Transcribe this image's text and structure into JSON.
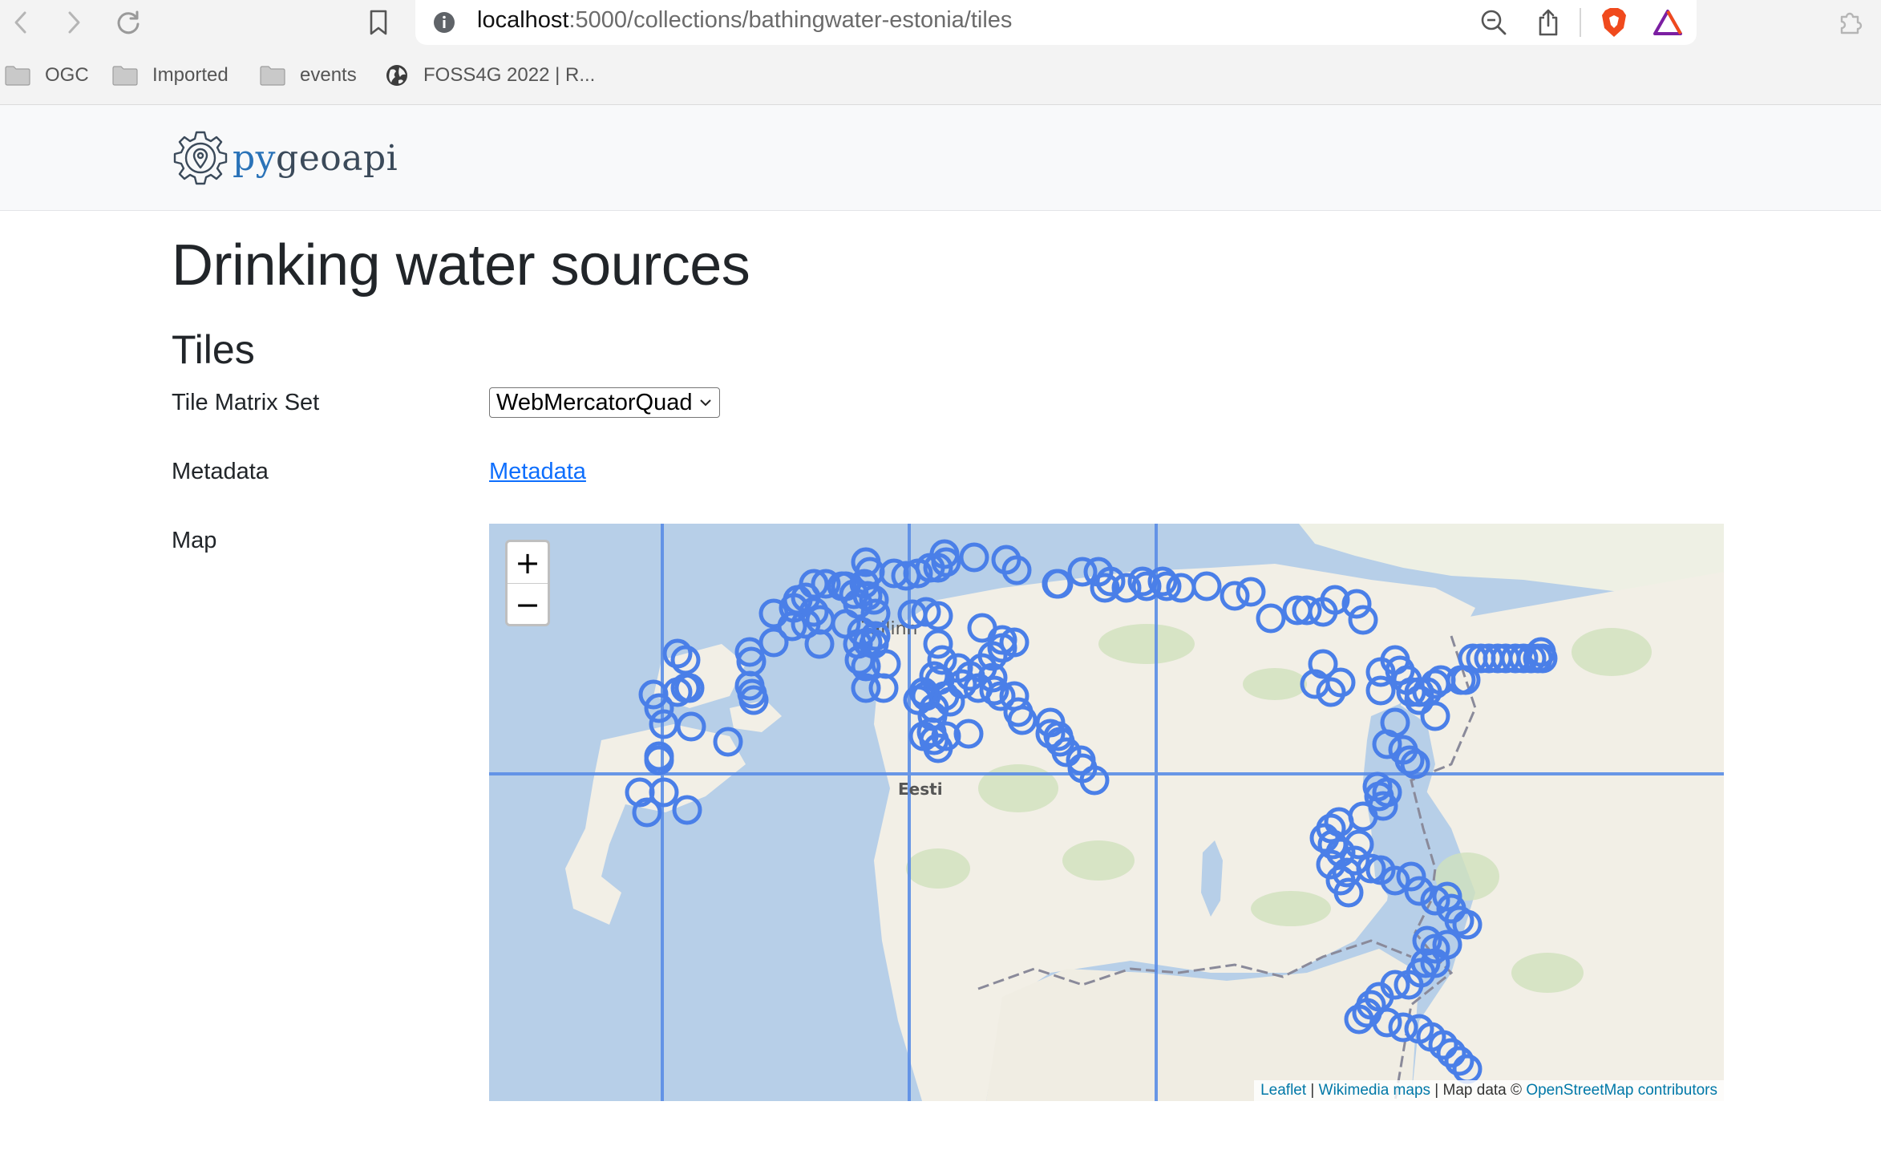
{
  "browser": {
    "url_host": "localhost",
    "url_path": ":5000/collections/bathingwater-estonia/tiles",
    "bookmarks": [
      {
        "label": "OGC",
        "icon": "folder-icon"
      },
      {
        "label": "Imported",
        "icon": "folder-icon"
      },
      {
        "label": "events",
        "icon": "folder-icon"
      },
      {
        "label": "FOSS4G 2022 | R...",
        "icon": "globe-icon"
      }
    ]
  },
  "site": {
    "logo_prefix": "py",
    "logo_suffix": "geoapi"
  },
  "page": {
    "title": "Drinking water sources",
    "section": "Tiles",
    "tms_label": "Tile Matrix Set",
    "tms_selected": "WebMercatorQuad",
    "metadata_label": "Metadata",
    "metadata_link": "Metadata",
    "map_label": "Map"
  },
  "map": {
    "zoom_in": "+",
    "zoom_out": "−",
    "country_label": "Eesti",
    "city_label": "Tallinn",
    "attribution": {
      "leaflet": "Leaflet",
      "sep1": " | ",
      "wikimedia": "Wikimedia maps",
      "mapdata": " | Map data © ",
      "osm": "OpenStreetMap contributors"
    },
    "colors": {
      "marker": "#4a7fe8",
      "grid": "#5a8de6",
      "sea": "#b7cfe8",
      "land": "#f2efe6"
    }
  }
}
